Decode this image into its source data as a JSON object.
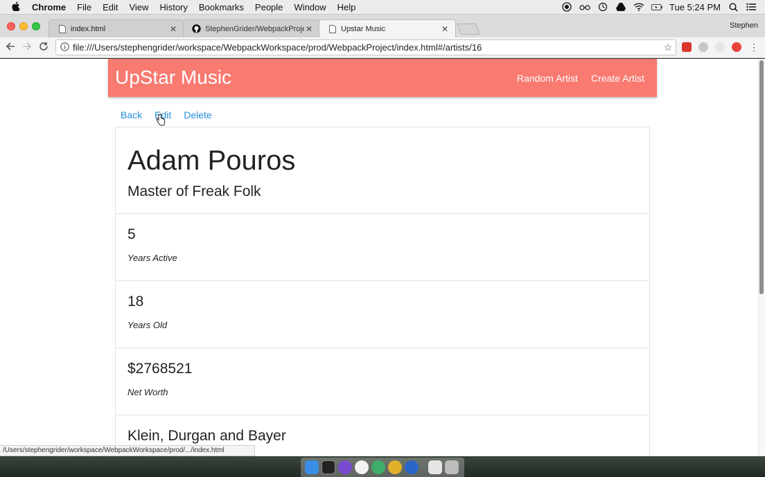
{
  "menubar": {
    "apple": "",
    "items": [
      "Chrome",
      "File",
      "Edit",
      "View",
      "History",
      "Bookmarks",
      "People",
      "Window",
      "Help"
    ],
    "clock": "Tue 5:24 PM"
  },
  "tabs": [
    {
      "title": "index.html"
    },
    {
      "title": "StephenGrider/WebpackProjec"
    },
    {
      "title": "Upstar Music"
    }
  ],
  "profile": "Stephen",
  "address": {
    "url": "file:///Users/stephengrider/workspace/WebpackWorkspace/prod/WebpackProject/index.html#/artists/16"
  },
  "app": {
    "brand": "UpStar Music",
    "nav": {
      "random": "Random Artist",
      "create": "Create Artist"
    },
    "actions": {
      "back": "Back",
      "edit": "Edit",
      "delete": "Delete"
    }
  },
  "artist": {
    "name": "Adam Pouros",
    "title": "Master of Freak Folk",
    "stats": [
      {
        "value": "5",
        "label": "Years Active"
      },
      {
        "value": "18",
        "label": "Years Old"
      },
      {
        "value": "$2768521",
        "label": "Net Worth"
      },
      {
        "value": "Klein, Durgan and Bayer",
        "label": ""
      }
    ]
  },
  "statusbar": "/Users/stephengrider/workspace/WebpackWorkspace/prod/.../index.html",
  "colors": {
    "navbar": "#f87a70",
    "link": "#1f8fd8"
  }
}
